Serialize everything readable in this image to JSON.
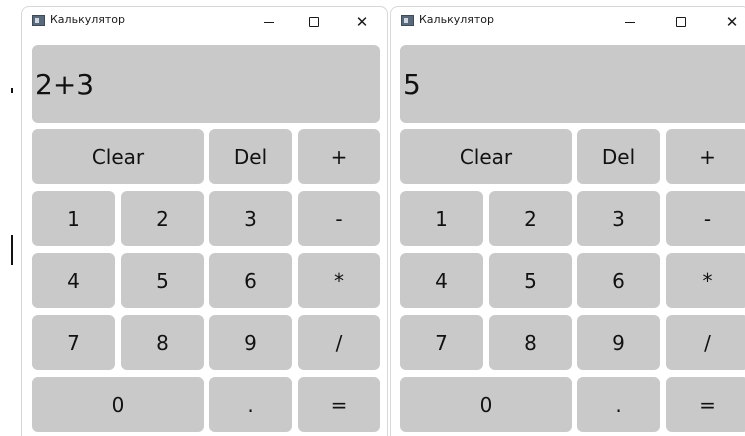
{
  "windows": [
    {
      "title": "Калькулятор",
      "display": "2+3",
      "keys": {
        "clear": "Clear",
        "del": "Del",
        "plus": "+",
        "one": "1",
        "two": "2",
        "three": "3",
        "minus": "-",
        "four": "4",
        "five": "5",
        "six": "6",
        "multiply": "*",
        "seven": "7",
        "eight": "8",
        "nine": "9",
        "divide": "/",
        "zero": "0",
        "dot": ".",
        "equals": "="
      }
    },
    {
      "title": "Калькулятор",
      "display": "5",
      "keys": {
        "clear": "Clear",
        "del": "Del",
        "plus": "+",
        "one": "1",
        "two": "2",
        "three": "3",
        "minus": "-",
        "four": "4",
        "five": "5",
        "six": "6",
        "multiply": "*",
        "seven": "7",
        "eight": "8",
        "nine": "9",
        "divide": "/",
        "zero": "0",
        "dot": ".",
        "equals": "="
      }
    }
  ],
  "caption_buttons": {
    "minimize": "—",
    "close": "✕"
  },
  "colors": {
    "button_bg": "#c9c9c9",
    "window_bg": "#ffffff"
  }
}
